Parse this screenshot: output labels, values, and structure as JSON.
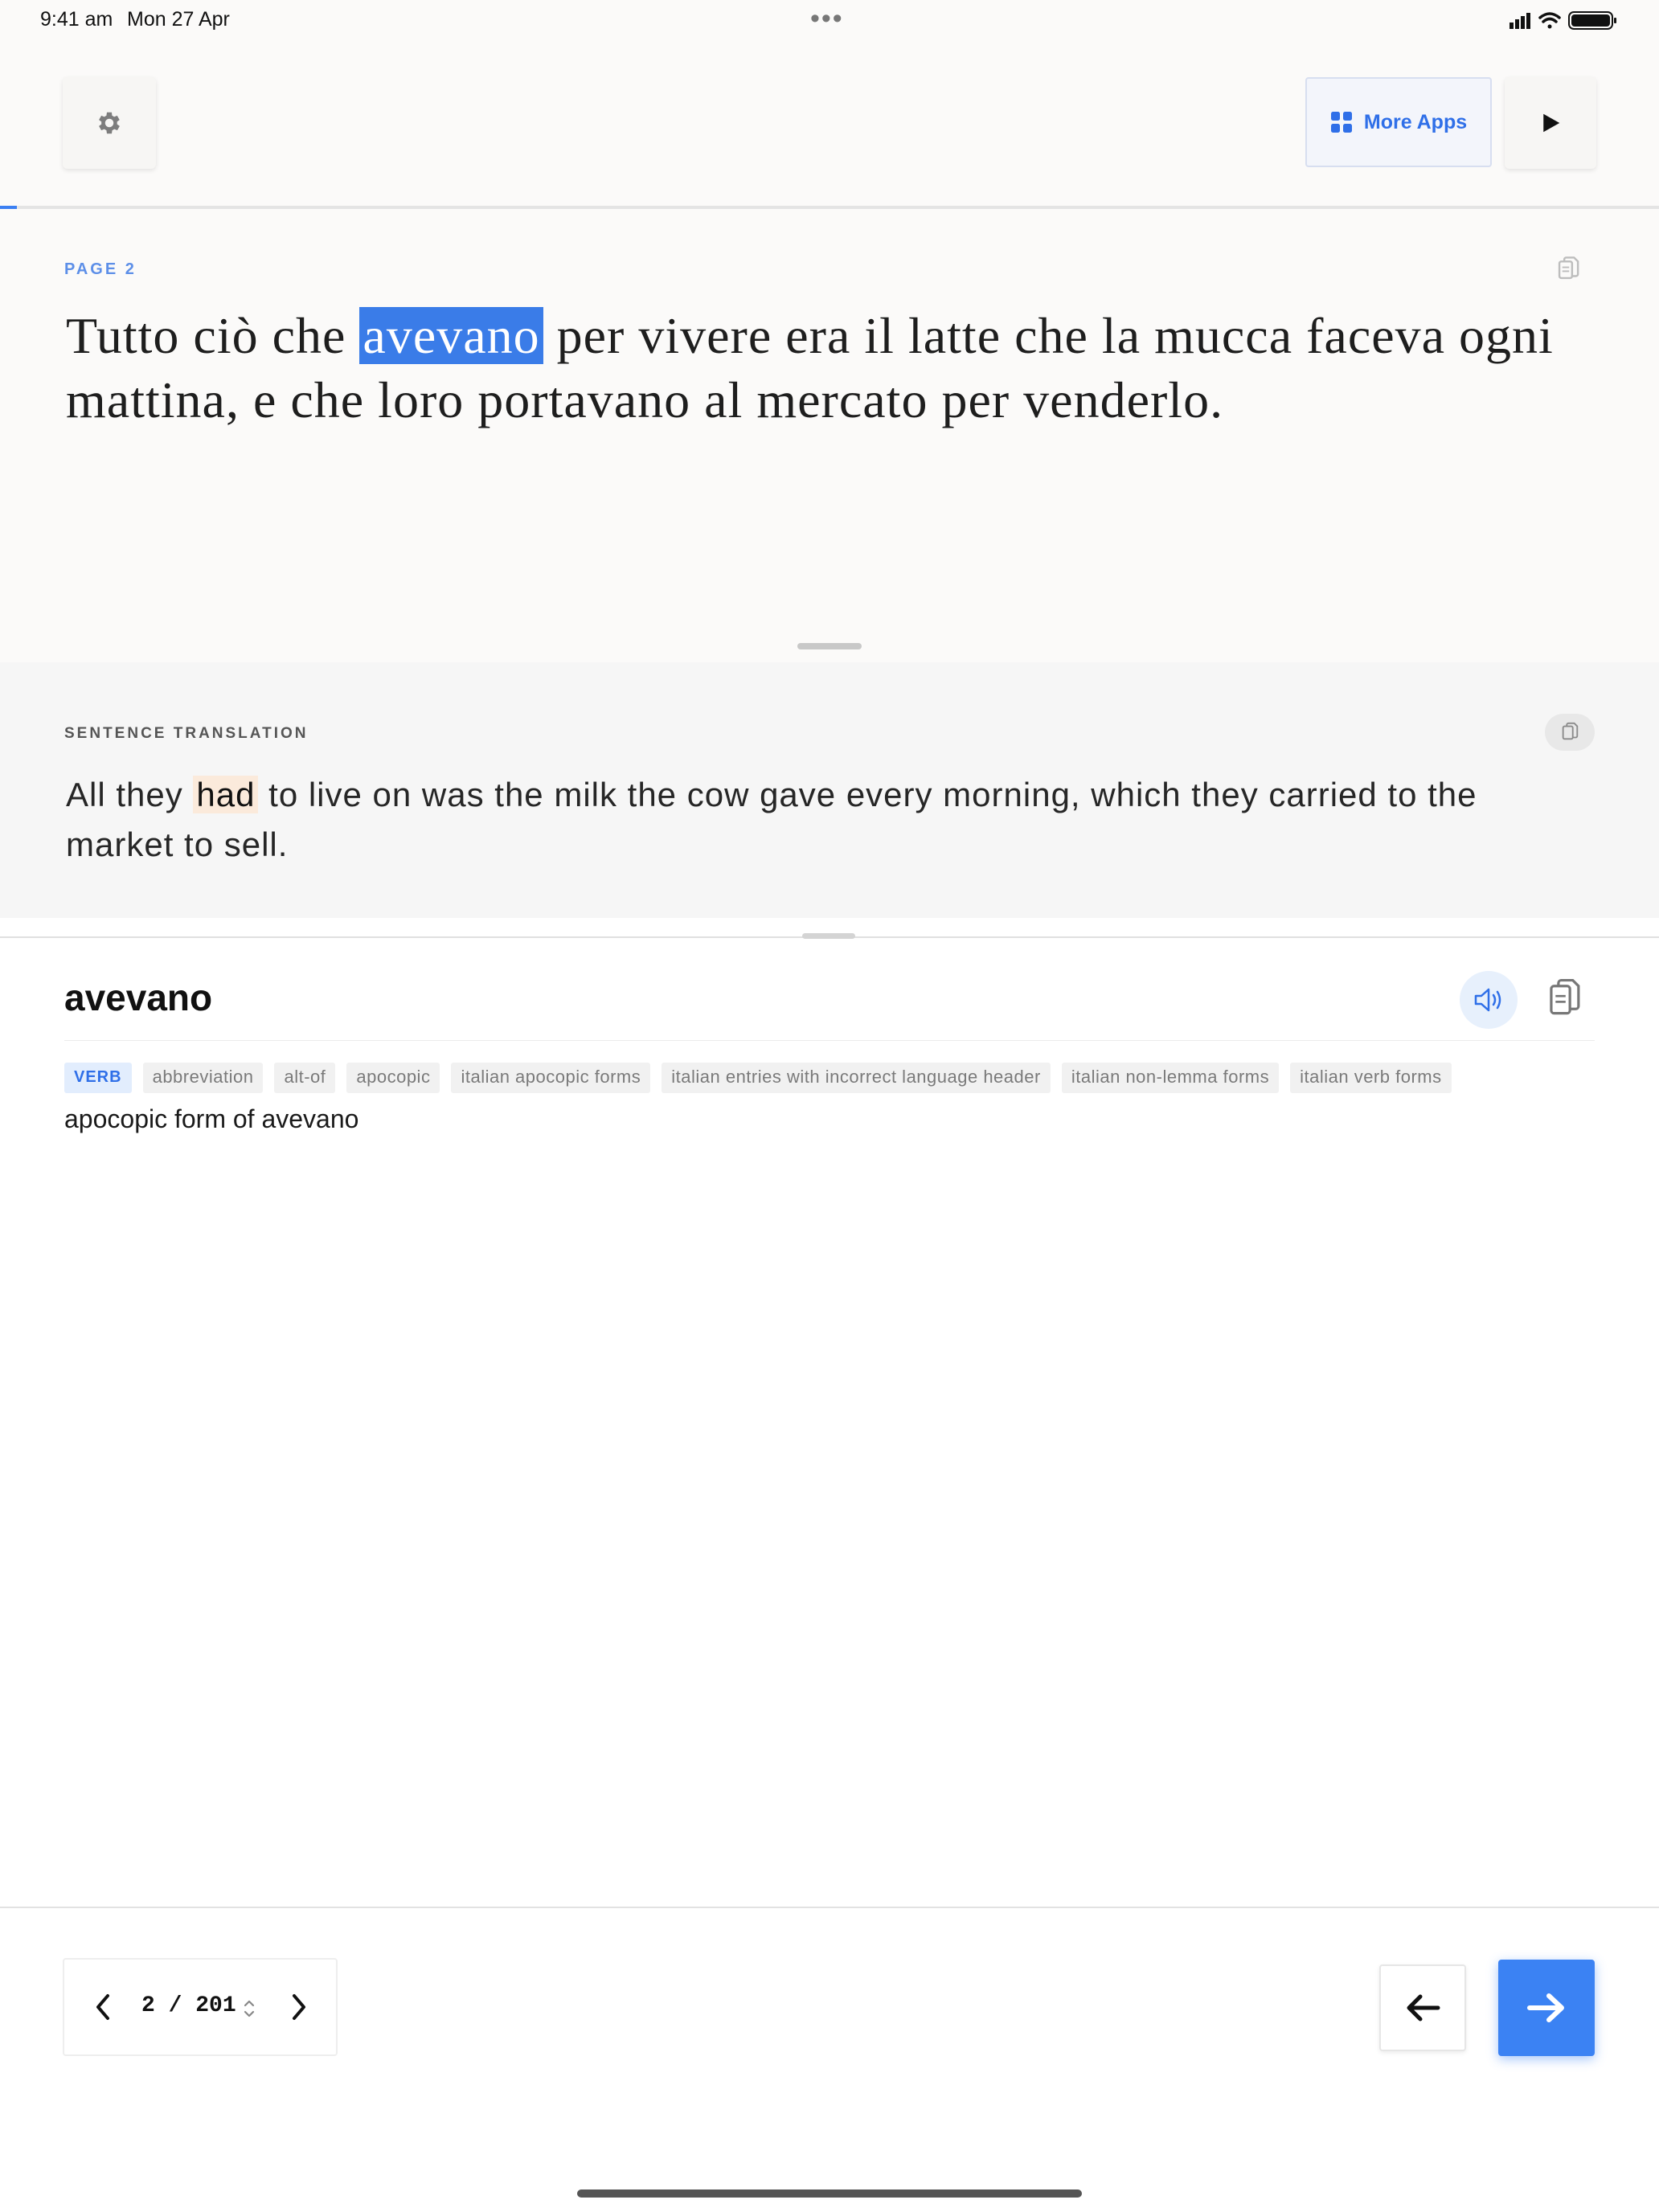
{
  "status_bar": {
    "time": "9:41 am",
    "date": "Mon 27 Apr",
    "dots": "•••"
  },
  "toolbar": {
    "settings_icon": "gear-icon",
    "more_apps_label": "More Apps",
    "more_apps_icon": "grid-icon",
    "play_icon": "play-icon"
  },
  "reader": {
    "page_label": "PAGE 2",
    "sentence_before": "Tutto ciò che ",
    "highlighted_word": "avevano",
    "sentence_after": " per vivere era il latte che la mucca faceva ogni mattina, e che loro portavano al mercato per venderlo."
  },
  "translation": {
    "label": "SENTENCE TRANSLATION",
    "text_before": "All they ",
    "highlighted_word": "had",
    "text_after": " to live on was the milk the cow gave every morning, which they carried to the market to sell."
  },
  "dictionary": {
    "word": "avevano",
    "tags": [
      "VERB",
      "abbreviation",
      "alt-of",
      "apocopic",
      "italian apocopic forms",
      "italian entries with incorrect language header",
      "italian non-lemma forms",
      "italian verb forms"
    ],
    "definition": "apocopic form of avevano"
  },
  "pager": {
    "current": "2",
    "separator": "/",
    "total": "201"
  },
  "colors": {
    "accent": "#3b82f3",
    "highlight": "#3a7ce8",
    "translation_highlight": "#fbeadb"
  },
  "progress": {
    "fraction": 0.00995
  }
}
